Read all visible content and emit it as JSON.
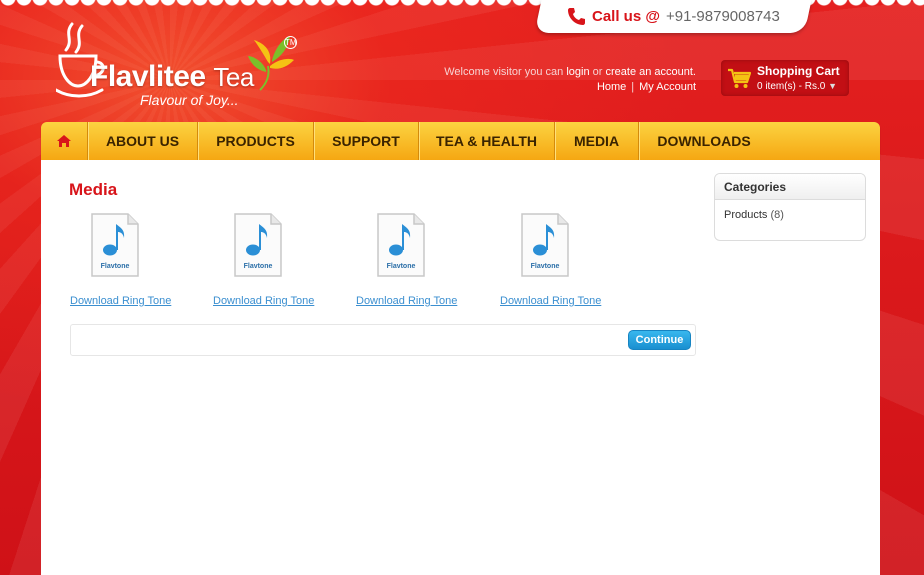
{
  "header": {
    "call_label": "Call us @",
    "call_number": "+91-9879008743",
    "logo_name": "Flavlitee",
    "logo_tea": "Tea",
    "logo_tagline": "Flavour of Joy...",
    "logo_tm": "TM",
    "welcome_text": "Welcome visitor you can",
    "login": "login",
    "or": "or",
    "create_account": "create an account.",
    "home": "Home",
    "my_account": "My Account",
    "separator": "|"
  },
  "cart": {
    "title": "Shopping Cart",
    "summary": "0 item(s) - Rs.0"
  },
  "nav": {
    "items": [
      "ABOUT US",
      "PRODUCTS",
      "SUPPORT",
      "TEA & HEALTH",
      "MEDIA",
      "DOWNLOADS"
    ]
  },
  "main": {
    "title": "Media",
    "media": [
      {
        "icon_label": "Flavtone",
        "link": "Download Ring Tone"
      },
      {
        "icon_label": "Flavtone",
        "link": "Download Ring Tone"
      },
      {
        "icon_label": "Flavtone",
        "link": "Download Ring Tone"
      },
      {
        "icon_label": "Flavtone",
        "link": "Download Ring Tone"
      }
    ],
    "continue": "Continue"
  },
  "sidebar": {
    "heading": "Categories",
    "items": [
      {
        "label": "Products",
        "count": "(8)"
      }
    ]
  },
  "colors": {
    "brand_red": "#d8141a",
    "nav_gold": "#f5a712",
    "link_blue": "#3b8fd0",
    "button_blue": "#1a8fd0"
  },
  "icons": {
    "phone": "phone-icon",
    "home": "home-icon",
    "cart": "cart-icon",
    "media_file": "music-file-icon"
  }
}
